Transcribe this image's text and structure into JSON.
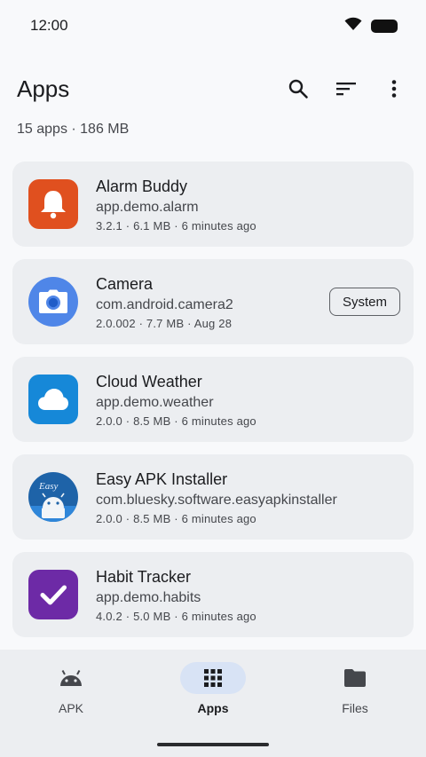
{
  "status": {
    "time": "12:00"
  },
  "header": {
    "title": "Apps",
    "summary": "15 apps · 186 MB"
  },
  "apps": [
    {
      "name": "Alarm Buddy",
      "package": "app.demo.alarm",
      "meta": "3.2.1 · 6.1 MB · 6 minutes ago",
      "icon": "bell-icon",
      "color": "#e0501f"
    },
    {
      "name": "Camera",
      "package": "com.android.camera2",
      "meta": "2.0.002 · 7.7 MB · Aug 28",
      "icon": "camera-icon",
      "color": "#4f86e8",
      "badge": "System"
    },
    {
      "name": "Cloud Weather",
      "package": "app.demo.weather",
      "meta": "2.0.0 · 8.5 MB · 6 minutes ago",
      "icon": "cloud-icon",
      "color": "#1688d8"
    },
    {
      "name": "Easy APK Installer",
      "package": "com.bluesky.software.easyapkinstaller",
      "meta": "2.0.0 · 8.5 MB · 6 minutes ago",
      "icon": "android-installer-icon",
      "color": "#1e63a8"
    },
    {
      "name": "Habit Tracker",
      "package": "app.demo.habits",
      "meta": "4.0.2 · 5.0 MB · 6 minutes ago",
      "icon": "check-icon",
      "color": "#6d2aa6"
    }
  ],
  "nav": [
    {
      "label": "APK",
      "icon": "android-icon",
      "active": false
    },
    {
      "label": "Apps",
      "icon": "grid-icon",
      "active": true
    },
    {
      "label": "Files",
      "icon": "folder-icon",
      "active": false
    }
  ],
  "icon_labels": {
    "easy": "Easy"
  }
}
